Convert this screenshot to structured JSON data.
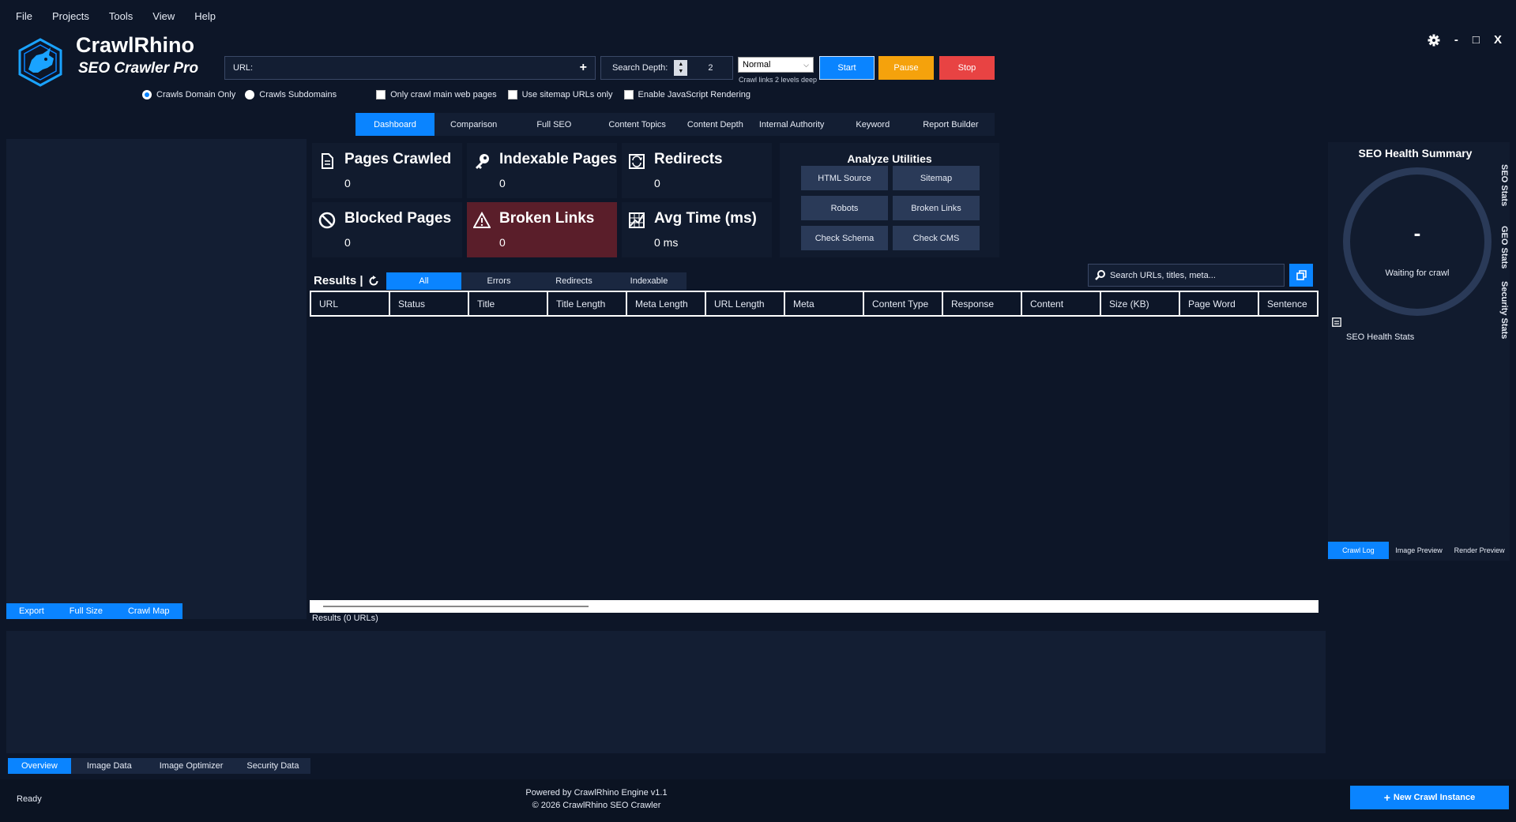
{
  "menu": [
    "File",
    "Projects",
    "Tools",
    "View",
    "Help"
  ],
  "brand": {
    "name": "CrawlRhino",
    "subtitle": "SEO Crawler Pro"
  },
  "url_input": {
    "label": "URL:",
    "value": "",
    "placeholder": ""
  },
  "search_depth": {
    "label": "Search Depth:",
    "value": "2"
  },
  "mode": {
    "selected": "Normal",
    "hint": "Crawl links 2 levels deep"
  },
  "controls": {
    "start": "Start",
    "pause": "Pause",
    "stop": "Stop"
  },
  "window_controls": {
    "minimize": "-",
    "maximize": "□",
    "close": "X"
  },
  "options": {
    "scope_domain": "Crawls Domain Only",
    "scope_subdomains": "Crawls Subdomains",
    "main_pages_only": "Only crawl main web pages",
    "sitemap_only": "Use sitemap URLs only",
    "js_rendering": "Enable JavaScript Rendering",
    "selected_scope": "domain"
  },
  "main_tabs": [
    "Dashboard",
    "Comparison",
    "Full SEO",
    "Content Topics",
    "Content Depth",
    "Internal Authority",
    "Keyword",
    "Report Builder"
  ],
  "main_tab_active": 0,
  "left_buttons": [
    "Export",
    "Full Size",
    "Crawl Map"
  ],
  "stats": {
    "pages_crawled": {
      "title": "Pages Crawled",
      "value": "0"
    },
    "indexable_pages": {
      "title": "Indexable Pages",
      "value": "0"
    },
    "redirects": {
      "title": "Redirects",
      "value": "0"
    },
    "blocked_pages": {
      "title": "Blocked Pages",
      "value": "0"
    },
    "broken_links": {
      "title": "Broken Links",
      "value": "0"
    },
    "avg_time": {
      "title": "Avg Time (ms)",
      "value": "0 ms"
    }
  },
  "utilities": {
    "title": "Analyze Utilities",
    "buttons": [
      "HTML Source",
      "Sitemap",
      "Robots",
      "Broken Links",
      "Check Schema",
      "Check CMS"
    ]
  },
  "results": {
    "title": "Results |",
    "tabs": [
      "All",
      "Errors",
      "Redirects",
      "Indexable"
    ],
    "active_tab": 0,
    "search_placeholder": "Search URLs, titles, meta...",
    "columns": [
      "URL",
      "Status",
      "Title",
      "Title Length",
      "Meta Length",
      "URL Length",
      "Meta",
      "Content Type",
      "Response",
      "Content",
      "Size (KB)",
      "Page Word",
      "Sentence"
    ],
    "rows": [],
    "count_text": "Results (0 URLs)"
  },
  "seo_health": {
    "title": "SEO Health Summary",
    "score": "-",
    "status": "Waiting for crawl",
    "stats_label": "SEO Health Stats",
    "side_tabs": [
      "SEO Stats",
      "GEO Stats",
      "Security Stats"
    ],
    "bottom_tabs": [
      "Crawl Log",
      "Image Preview",
      "Render Preview"
    ]
  },
  "bottom_tabs": [
    "Overview",
    "Image Data",
    "Image Optimizer",
    "Security Data"
  ],
  "footer": {
    "status": "Ready",
    "powered": "Powered by CrawlRhino Engine v1.1",
    "copyright": "© 2026 CrawlRhino SEO Crawler",
    "new_instance": "New Crawl Instance"
  },
  "colors": {
    "background": "#0d1628",
    "panel": "#131e33",
    "accent": "#0a84ff",
    "pause": "#f5a20c",
    "stop": "#e84343",
    "danger_card": "#5a1e2a"
  }
}
